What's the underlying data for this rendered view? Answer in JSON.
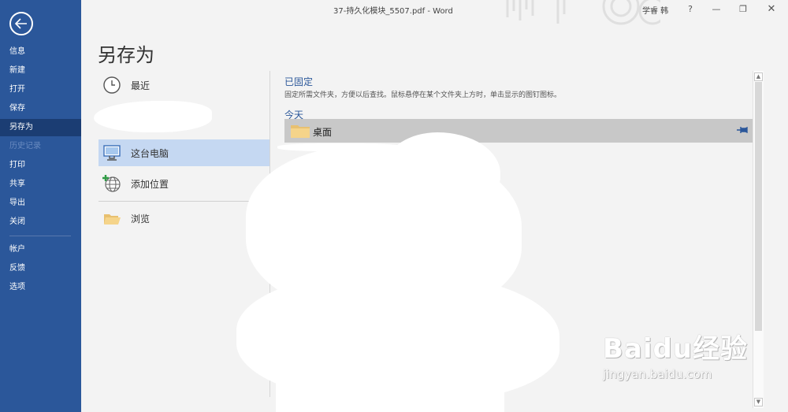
{
  "titlebar": {
    "document_title": "37-持久化模块_5507.pdf - Word",
    "user_name": "学睿 韩",
    "help": "?",
    "minimize": "—",
    "restore": "❐",
    "close": "✕"
  },
  "nav": {
    "items": [
      {
        "label": "信息"
      },
      {
        "label": "新建"
      },
      {
        "label": "打开"
      },
      {
        "label": "保存"
      },
      {
        "label": "另存为"
      },
      {
        "label": "历史记录"
      },
      {
        "label": "打印"
      },
      {
        "label": "共享"
      },
      {
        "label": "导出"
      },
      {
        "label": "关闭"
      },
      {
        "label": "帐户"
      },
      {
        "label": "反馈"
      },
      {
        "label": "选项"
      }
    ],
    "active": "另存为",
    "disabled": "历史记录"
  },
  "page_title": "另存为",
  "locations": [
    {
      "label": "最近",
      "icon": "clock-icon"
    },
    {
      "label": "",
      "icon": "onedrive-icon"
    },
    {
      "label": "这台电脑",
      "icon": "computer-icon"
    },
    {
      "label": "添加位置",
      "icon": "globe-add-icon"
    },
    {
      "label": "浏览",
      "icon": "folder-open-icon"
    }
  ],
  "right_panel": {
    "pinned_heading": "已固定",
    "pinned_description": "固定所需文件夹，方便以后查找。鼠标悬停在某个文件夹上方时，单击显示的图钉图标。",
    "today_heading": "今天",
    "folders": [
      {
        "label": "桌面",
        "icon": "folder-icon"
      }
    ]
  },
  "watermark": {
    "brand": "Baidu经验",
    "url": "jingyan.baidu.com"
  },
  "colors": {
    "nav_bg": "#2b579a",
    "nav_active": "#1b3d73",
    "selected_location": "#c5d8f2",
    "heading_blue": "#2b579a"
  }
}
